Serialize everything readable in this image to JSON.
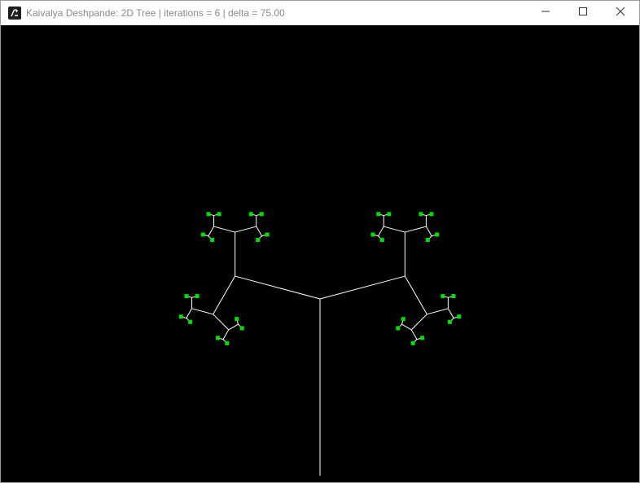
{
  "window": {
    "title": "Kaivalya Deshpande: 2D Tree | iterations = 6 | delta = 75.00",
    "app_icon": "processing-icon",
    "controls": [
      "minimize-icon",
      "maximize-icon",
      "close-icon"
    ]
  },
  "tree": {
    "iterations": 6,
    "delta_degrees": 75.0,
    "branch_color": "#ffffff",
    "leaf_color": "#00e000",
    "background_color": "#000000"
  }
}
